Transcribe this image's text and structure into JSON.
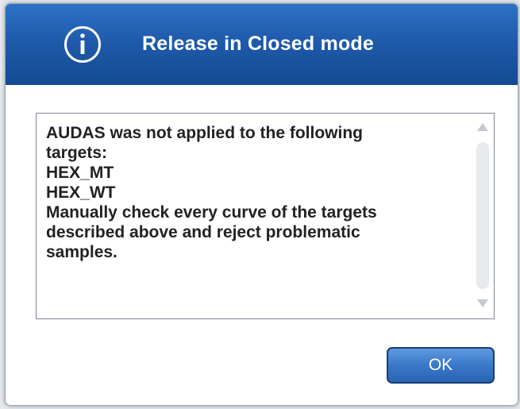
{
  "dialog": {
    "title": "Release in Closed mode",
    "icon": "info-icon",
    "message_lines": [
      "AUDAS was not applied to the following",
      "targets:",
      "HEX_MT",
      "HEX_WT",
      "Manually check every curve of the targets",
      "described above and reject problematic",
      "samples."
    ],
    "ok_label": "OK"
  },
  "colors": {
    "title_bar": "#1f5bab",
    "button": "#3a78c8",
    "text": "#222222"
  }
}
